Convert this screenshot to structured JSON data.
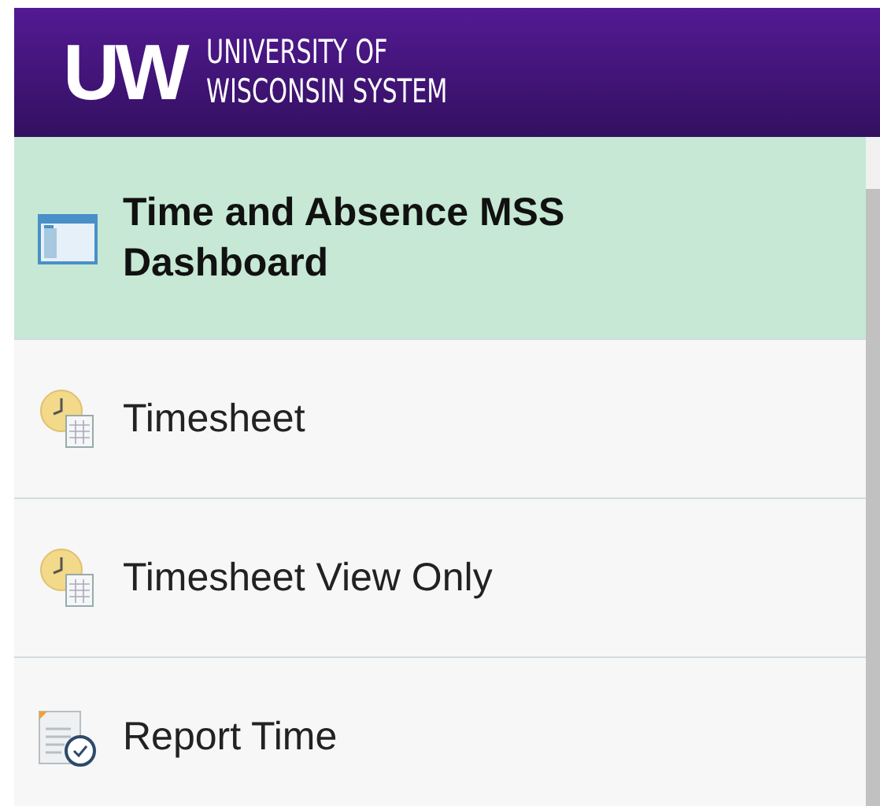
{
  "header": {
    "logo_mark": "UW",
    "logo_line_1": "UNIVERSITY OF",
    "logo_line_2": "WISCONSIN SYSTEM"
  },
  "menu": {
    "items": [
      {
        "label": "Time and Absence MSS Dashboard",
        "kind": "dashboard",
        "selected": true
      },
      {
        "label": "Timesheet",
        "kind": "timesheet",
        "selected": false
      },
      {
        "label": "Timesheet View Only",
        "kind": "timesheet",
        "selected": false
      },
      {
        "label": "Report Time",
        "kind": "report",
        "selected": false
      }
    ]
  }
}
